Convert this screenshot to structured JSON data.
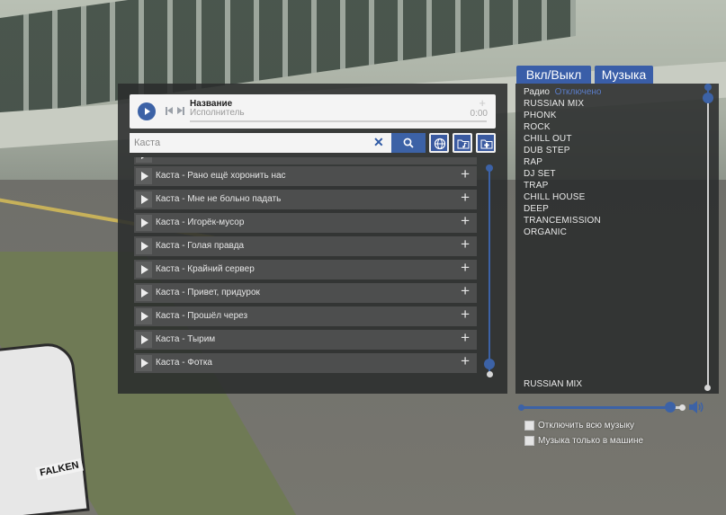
{
  "now_playing": {
    "title": "Название",
    "artist": "Исполнитель",
    "time": "0:00",
    "progress": 0,
    "add_glyph": "+"
  },
  "search": {
    "query": "Каста",
    "clear_glyph": "✕"
  },
  "tracks": [
    {
      "title": "Каста - Рано ещё хоронить нас"
    },
    {
      "title": "Каста - Мне не больно падать"
    },
    {
      "title": "Каста - Игорёк-мусор"
    },
    {
      "title": "Каста - Голая правда"
    },
    {
      "title": "Каста - Крайний сервер"
    },
    {
      "title": "Каста - Привет, придурок"
    },
    {
      "title": "Каста - Прошёл через"
    },
    {
      "title": "Каста - Тырим"
    },
    {
      "title": "Каста - Фотка"
    }
  ],
  "track_add_glyph": "+",
  "tabs": {
    "toggle": "Вкл/Выкл",
    "music": "Музыка"
  },
  "radio": {
    "label": "Радио",
    "status": "Отключено",
    "stations": [
      "RUSSIAN MIX",
      "PHONK",
      "ROCK",
      "CHILL OUT",
      "DUB STEP",
      "RAP",
      "DJ SET",
      "TRAP",
      "CHILL HOUSE",
      "DEEP",
      "TRANCEMISSION",
      "ORGANIC"
    ],
    "current": "RUSSIAN MIX"
  },
  "volume": {
    "level": 0.92
  },
  "options": {
    "disable_all_music": "Отключить всю музыку",
    "music_only_in_car": "Музыка только в машине"
  },
  "colors": {
    "accent": "#3c62a6",
    "panel": "#2a2c2c",
    "row": "#4d4e4e",
    "status": "#5a7cc8"
  },
  "icons": {
    "search": "search-icon",
    "globe": "globe-icon",
    "music_folder": "music-folder-icon",
    "add_folder": "add-folder-icon",
    "speaker": "speaker-icon"
  },
  "background": {
    "car_text": "FALKEN"
  }
}
